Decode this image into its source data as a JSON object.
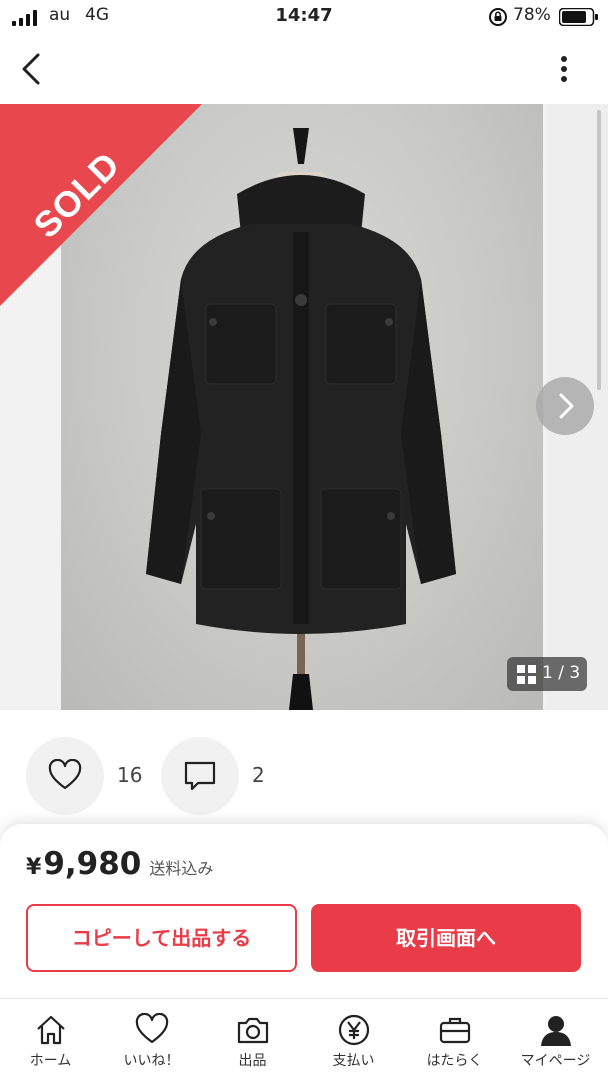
{
  "status_bar": {
    "carrier": "au",
    "network": "4G",
    "time": "14:47",
    "battery_percent": "78%",
    "icons": [
      "signal-icon",
      "rotation-lock-icon",
      "battery-icon"
    ]
  },
  "nav": {
    "icons": [
      "back-icon",
      "more-icon"
    ]
  },
  "gallery": {
    "sold_badge": "SOLD",
    "counter": "1 / 3",
    "current_index": 1,
    "total": 3
  },
  "engagement": {
    "likes": "16",
    "comments": "2"
  },
  "purchase": {
    "currency": "¥",
    "price": "9,980",
    "shipping": "送料込み",
    "copy_button": "コピーして出品する",
    "trade_button": "取引画面へ"
  },
  "tabbar": {
    "items": [
      {
        "label": "ホーム",
        "icon": "home-icon"
      },
      {
        "label": "いいね！",
        "icon": "heart-icon"
      },
      {
        "label": "出品",
        "icon": "camera-icon"
      },
      {
        "label": "支払い",
        "icon": "yen-icon"
      },
      {
        "label": "はたらく",
        "icon": "briefcase-icon"
      },
      {
        "label": "マイページ",
        "icon": "person-icon"
      }
    ]
  },
  "colors": {
    "accent": "#ea3c48",
    "sold": "#e8474e"
  }
}
